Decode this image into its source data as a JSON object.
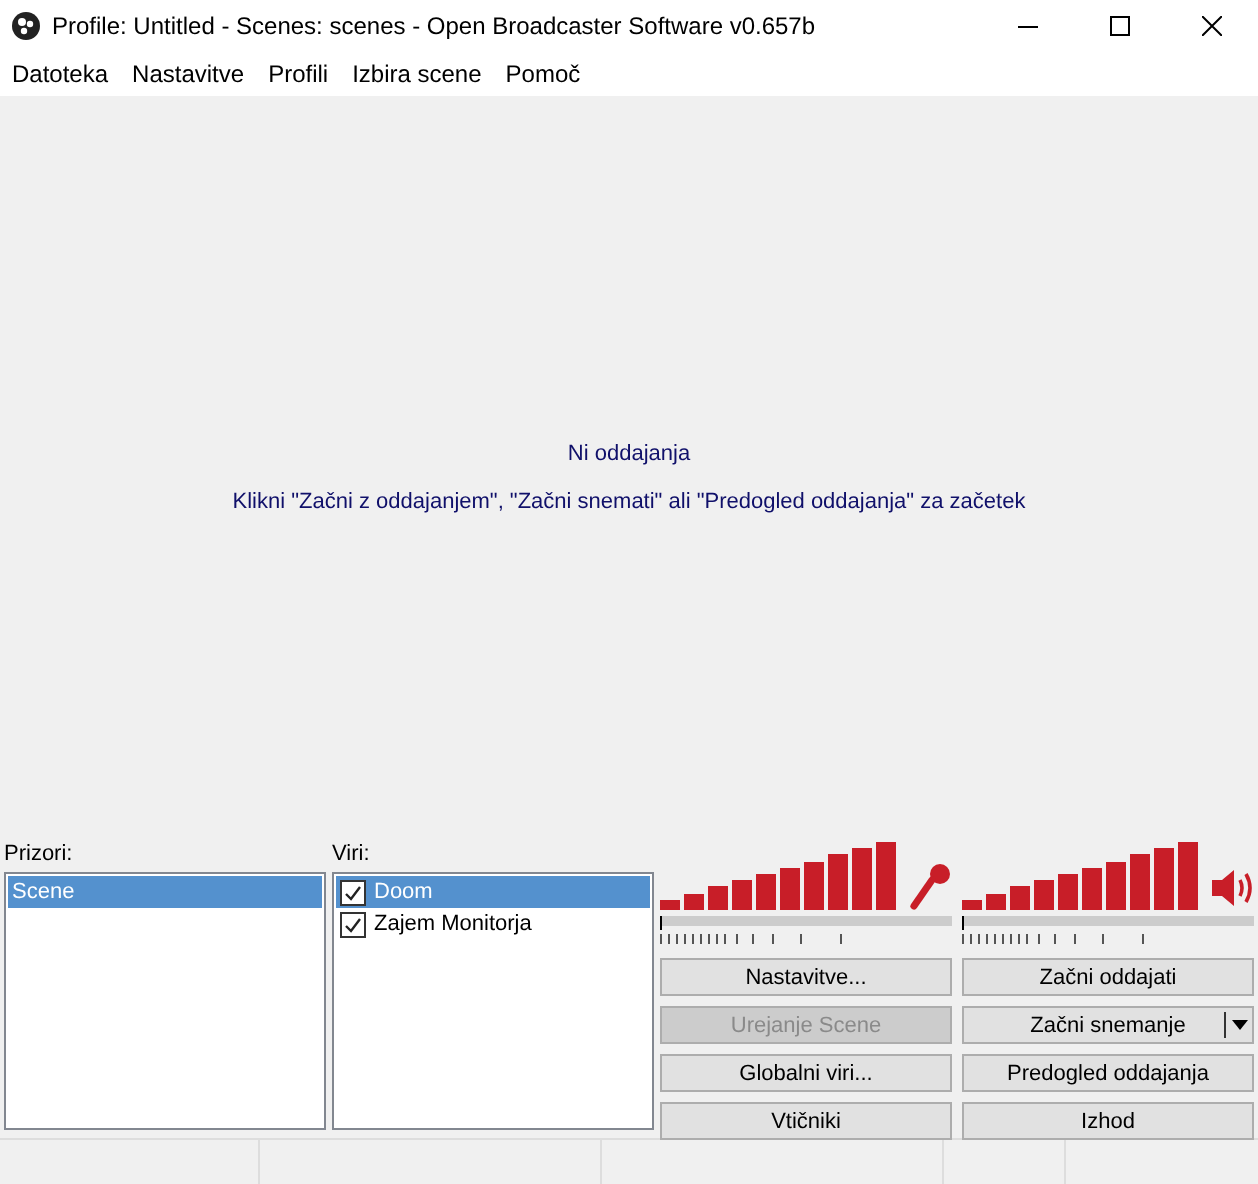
{
  "window": {
    "title": "Profile: Untitled - Scenes: scenes - Open Broadcaster Software v0.657b"
  },
  "menu": [
    "Datoteka",
    "Nastavitve",
    "Profili",
    "Izbira scene",
    "Pomoč"
  ],
  "preview": {
    "status": "Ni oddajanja",
    "hint": "Klikni \"Začni z oddajanjem\", \"Začni snemati\" ali \"Predogled oddajanja\" za začetek"
  },
  "scenes": {
    "label": "Prizori:",
    "items": [
      {
        "name": "Scene",
        "selected": true
      }
    ]
  },
  "sources": {
    "label": "Viri:",
    "items": [
      {
        "name": "Doom",
        "checked": true,
        "selected": true
      },
      {
        "name": "Zajem Monitorja",
        "checked": true,
        "selected": false
      }
    ]
  },
  "mic_volume": {
    "level": 0
  },
  "desktop_volume": {
    "level": 0
  },
  "buttons": [
    {
      "label": "Nastavitve...",
      "disabled": false
    },
    {
      "label": "Začni oddajati",
      "disabled": false
    },
    {
      "label": "Urejanje Scene",
      "disabled": true
    },
    {
      "label": "Začni snemanje",
      "disabled": false,
      "kind": "split"
    },
    {
      "label": "Globalni viri...",
      "disabled": false
    },
    {
      "label": "Predogled oddajanja",
      "disabled": false
    },
    {
      "label": "Vtičniki",
      "disabled": false
    },
    {
      "label": "Izhod",
      "disabled": false
    }
  ]
}
